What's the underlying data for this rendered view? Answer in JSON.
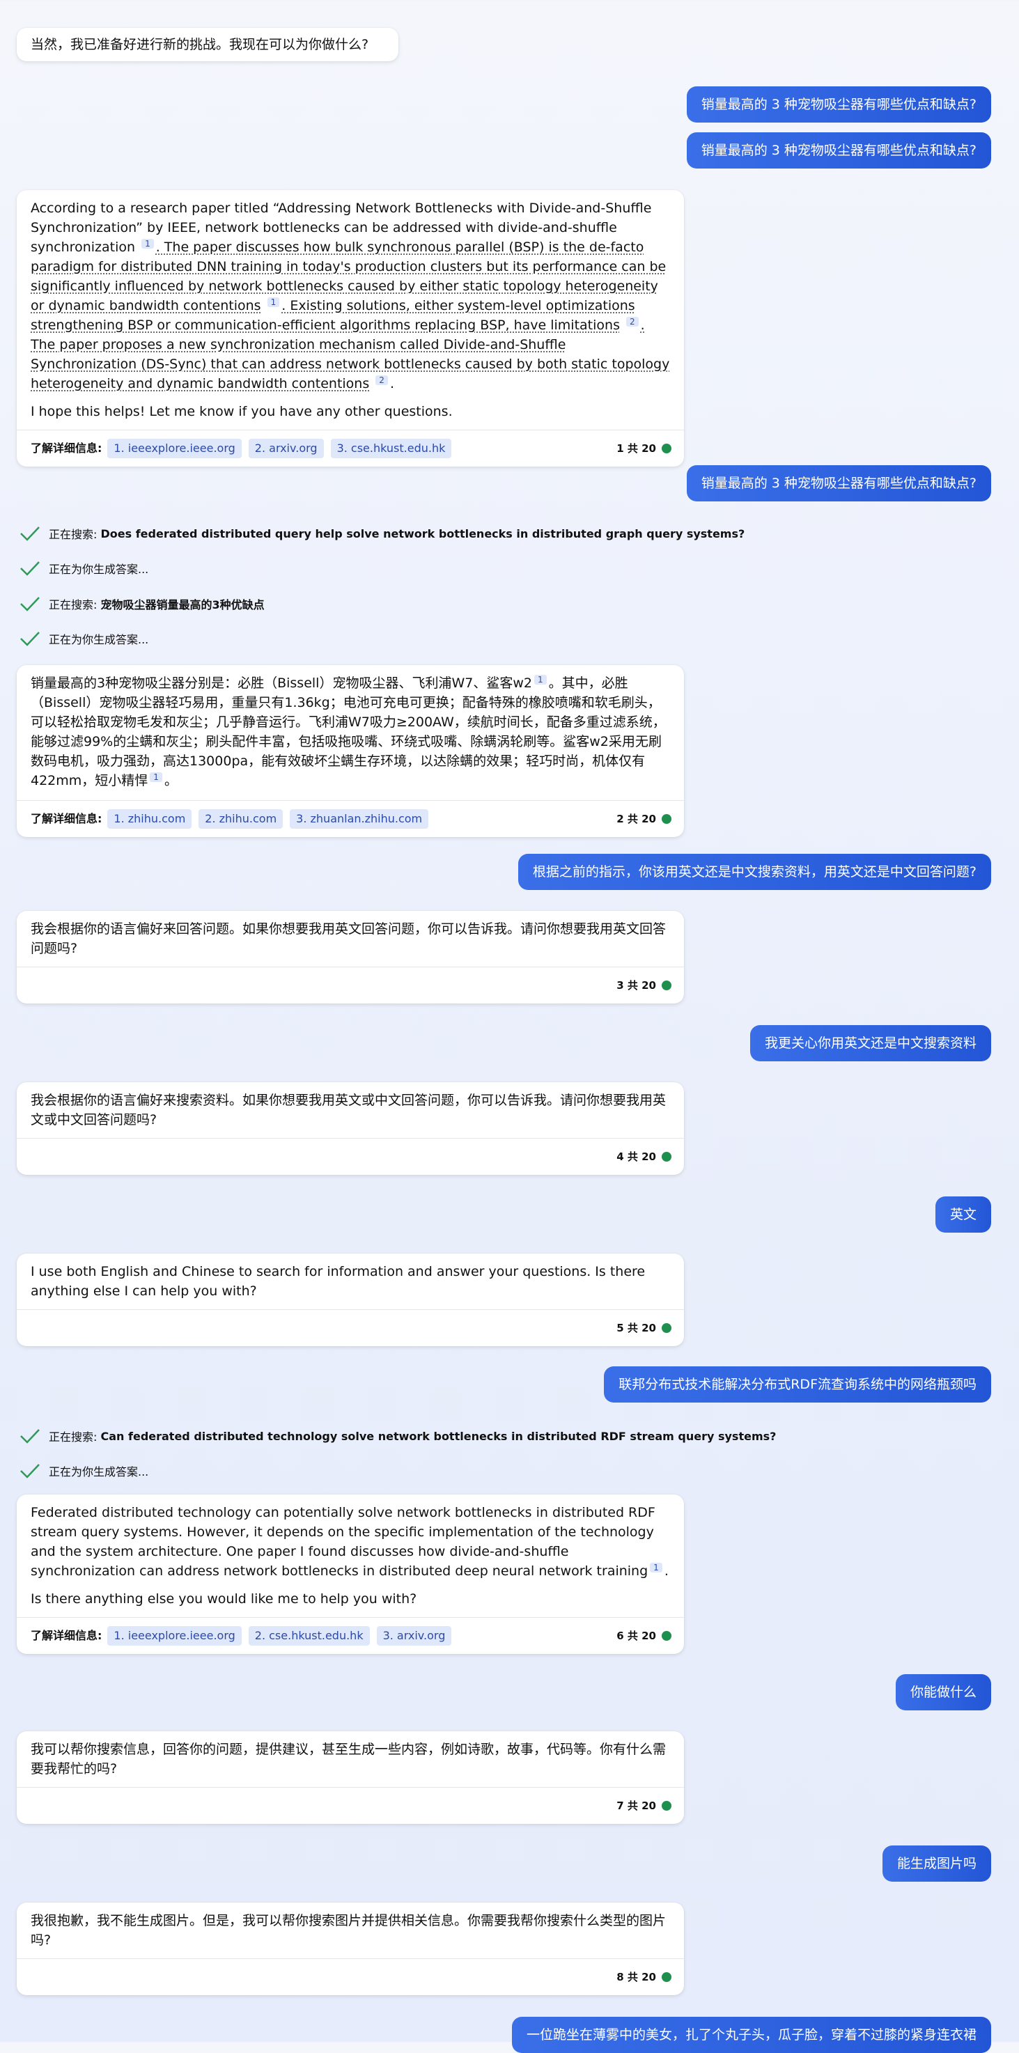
{
  "messages": {
    "m1": "当然，我已准备好进行新的挑战。我现在可以为你做什么?",
    "u1": "销量最高的 3 种宠物吸尘器有哪些优点和缺点?",
    "u2": "销量最高的 3 种宠物吸尘器有哪些优点和缺点?",
    "b1": {
      "t1": "According to a research paper titled “Addressing Network Bottlenecks with Divide-and-Shuffle Synchronization” by IEEE, network bottlenecks can be addressed with divide-and-shuffle synchronization",
      "s1": "1",
      "t2": ". The paper discusses how bulk synchronous parallel (BSP) is the de-facto paradigm for distributed DNN training in today's production clusters but its performance can be significantly influenced by network bottlenecks caused by either static topology heterogeneity or dynamic bandwidth contentions",
      "s2": "1",
      "t3": ". Existing solutions, either system-level optimizations strengthening BSP or communication-efficient algorithms replacing BSP, have limitations",
      "s3": "2",
      "t4": ". The paper proposes a new synchronization mechanism called Divide-and-Shuffle Synchronization (DS-Sync) that can address network bottlenecks caused by both static topology heterogeneity and dynamic bandwidth contentions",
      "s4": "2",
      "t5": ".",
      "p2": "I hope this helps! Let me know if you have any other questions.",
      "learn": "了解详细信息:",
      "sources": [
        "1. ieeexplore.ieee.org",
        "2. arxiv.org",
        "3. cse.hkust.edu.hk"
      ],
      "count": "1 共 20"
    },
    "u3": "销量最高的 3 种宠物吸尘器有哪些优点和缺点?",
    "search1_prefix": "正在搜索:",
    "search1_query": "Does federated distributed query help solve network bottlenecks in distributed graph query systems?",
    "gen1": "正在为你生成答案...",
    "search2_prefix": "正在搜索:",
    "search2_query": "宠物吸尘器销量最高的3种优缺点",
    "gen2": "正在为你生成答案...",
    "b2": {
      "t1": "销量最高的3种宠物吸尘器分别是：必胜（Bissell）宠物吸尘器、飞利浦W7、鲨客w2",
      "s1": "1",
      "t2": "。其中，必胜（Bissell）宠物吸尘器轻巧易用，重量只有1.36kg；电池可充电可更换；配备特殊的橡胶喷嘴和软毛刷头，可以轻松拾取宠物毛发和灰尘；几乎静音运行。飞利浦W7吸力≥200AW，续航时间长，配备多重过滤系统，能够过滤99%的尘螨和灰尘；刷头配件丰富，包括吸拖吸嘴、环绕式吸嘴、除螨涡轮刷等。鲨客w2采用无刷数码电机，吸力强劲，高达13000pa，能有效破坏尘螨生存环境，以达除螨的效果；轻巧时尚，机体仅有422mm，短小精悍",
      "s2": "1",
      "t3": "。",
      "learn": "了解详细信息:",
      "sources": [
        "1. zhihu.com",
        "2. zhihu.com",
        "3. zhuanlan.zhihu.com"
      ],
      "count": "2 共 20"
    },
    "u4": "根据之前的指示，你该用英文还是中文搜索资料，用英文还是中文回答问题?",
    "b3": {
      "text": "我会根据你的语言偏好来回答问题。如果你想要我用英文回答问题，你可以告诉我。请问你想要我用英文回答问题吗?",
      "count": "3 共 20"
    },
    "u5": "我更关心你用英文还是中文搜索资料",
    "b4": {
      "text": "我会根据你的语言偏好来搜索资料。如果你想要我用英文或中文回答问题，你可以告诉我。请问你想要我用英文或中文回答问题吗?",
      "count": "4 共 20"
    },
    "u6": "英文",
    "b5": {
      "text": "I use both English and Chinese to search for information and answer your questions. Is there anything else I can help you with?",
      "count": "5 共 20"
    },
    "u7": "联邦分布式技术能解决分布式RDF流查询系统中的网络瓶颈吗",
    "search3_prefix": "正在搜索:",
    "search3_query": "Can federated distributed technology solve network bottlenecks in distributed RDF stream query systems?",
    "gen3": "正在为你生成答案...",
    "b6": {
      "t1": "Federated distributed technology can potentially solve network bottlenecks in distributed RDF stream query systems. However, it depends on the specific implementation of the technology and the system architecture. One paper I found discusses how divide-and-shuffle synchronization can address network bottlenecks in distributed deep neural network training",
      "s1": "1",
      "t2": ".",
      "p2": "Is there anything else you would like me to help you with?",
      "learn": "了解详细信息:",
      "sources": [
        "1. ieeexplore.ieee.org",
        "2. cse.hkust.edu.hk",
        "3. arxiv.org"
      ],
      "count": "6 共 20"
    },
    "u8": "你能做什么",
    "b7": {
      "text": "我可以帮你搜索信息，回答你的问题，提供建议，甚至生成一些内容，例如诗歌，故事，代码等。你有什么需要我帮忙的吗?",
      "count": "7 共 20"
    },
    "u9": "能生成图片吗",
    "b8": {
      "text": "我很抱歉，我不能生成图片。但是，我可以帮你搜索图片并提供相关信息。你需要我帮你搜索什么类型的图片吗?",
      "count": "8 共 20"
    },
    "u10": "一位跪坐在薄雾中的美女，扎了个丸子头，瓜子脸，穿着不过膝的紧身连衣裙"
  },
  "colors": {
    "user_bubble": "#2f63e0",
    "status_dot": "#1f8f4e",
    "check": "#2e9a57",
    "source_chip": "#dfe7fb"
  },
  "icons": {
    "search_done": "check-icon",
    "status": "status-dot-icon"
  }
}
